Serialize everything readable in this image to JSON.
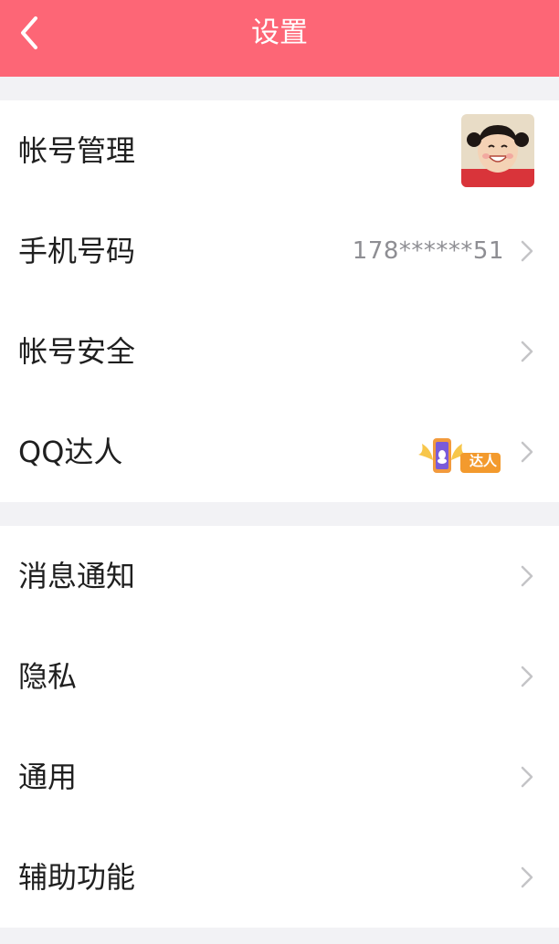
{
  "header": {
    "title": "设置",
    "back_icon": "chevron-left-icon",
    "color": "#fd6676"
  },
  "group1": {
    "account": {
      "label": "帐号管理"
    },
    "phone": {
      "label": "手机号码",
      "value": "178******51"
    },
    "security": {
      "label": "帐号安全"
    },
    "qq_expert": {
      "label": "QQ达人",
      "badge_text": "达人"
    }
  },
  "group2": {
    "notifications": {
      "label": "消息通知"
    },
    "privacy": {
      "label": "隐私"
    },
    "general": {
      "label": "通用"
    },
    "accessibility": {
      "label": "辅助功能"
    }
  }
}
